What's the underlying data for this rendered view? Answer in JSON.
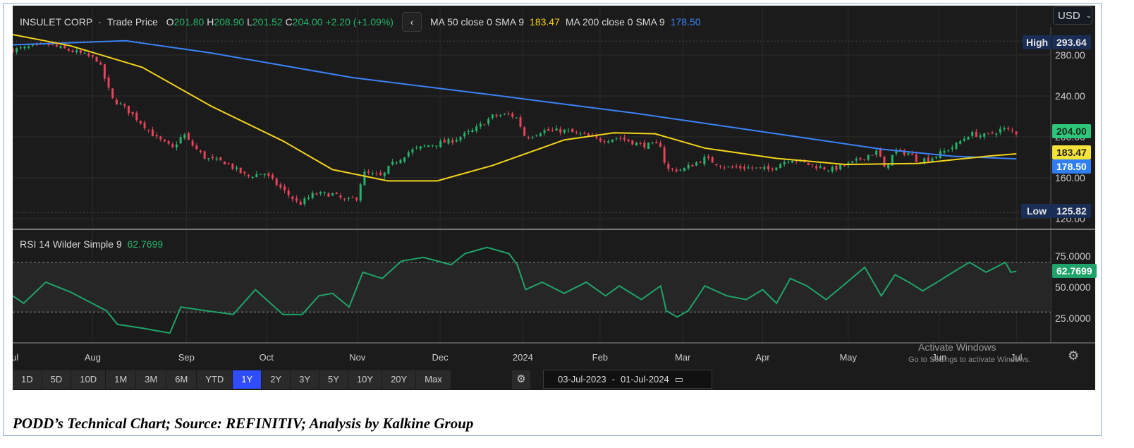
{
  "header": {
    "name": "INSULET CORP",
    "sep": "·",
    "series": "Trade Price",
    "o_label": "O",
    "o": "201.80",
    "h_label": "H",
    "h": "208.90",
    "l_label": "L",
    "l": "201.52",
    "c_label": "C",
    "c": "204.00",
    "change": "+2.20 (+1.09%)",
    "back_icon": "chevron-left-icon",
    "ma50_label": "MA 50 close 0 SMA 9",
    "ma50_value": "183.47",
    "ma200_label": "MA 200 close 0 SMA 9",
    "ma200_value": "178.50"
  },
  "currency": {
    "value": "USD",
    "icon": "chevron-down-icon"
  },
  "price_tags": {
    "high_label": "High",
    "high": "293.64",
    "low_label": "Low",
    "low": "125.82",
    "last": "204.00",
    "ma50": "183.47",
    "ma200": "178.50"
  },
  "rsi": {
    "label": "RSI 14 Wilder Simple 9",
    "value": "62.7699"
  },
  "ranges": [
    "1D",
    "5D",
    "10D",
    "1M",
    "3M",
    "6M",
    "YTD",
    "1Y",
    "2Y",
    "3Y",
    "5Y",
    "10Y",
    "20Y",
    "Max"
  ],
  "active_range": "1Y",
  "date_range": {
    "from": "03-Jul-2023",
    "sep": "-",
    "to": "01-Jul-2024"
  },
  "watermark": {
    "line1": "Activate Windows",
    "line2": "Go to Settings to activate Windows."
  },
  "caption": "PODD’s Technical Chart; Source: REFINITIV; Analysis by Kalkine Group",
  "colors": {
    "up": "#26b36b",
    "down": "#e8435a",
    "ma50": "#f2d31b",
    "ma200": "#3b82f6",
    "rsi": "#1fa36a",
    "bg": "#1b1b1b"
  },
  "chart_data": [
    {
      "type": "candlestick",
      "title": "INSULET CORP · Trade Price",
      "x_unit": "days since 03-Jul-2023",
      "ylim": [
        115,
        300
      ],
      "y_ticks": [
        120,
        160,
        200,
        240,
        280
      ],
      "x_ticks": [
        {
          "label": "Jul",
          "day": 0
        },
        {
          "label": "Aug",
          "day": 29
        },
        {
          "label": "Sep",
          "day": 63
        },
        {
          "label": "Oct",
          "day": 92
        },
        {
          "label": "Nov",
          "day": 125
        },
        {
          "label": "Dec",
          "day": 155
        },
        {
          "label": "2024",
          "day": 185
        },
        {
          "label": "Feb",
          "day": 213
        },
        {
          "label": "Mar",
          "day": 243
        },
        {
          "label": "Apr",
          "day": 272
        },
        {
          "label": "May",
          "day": 303
        },
        {
          "label": "Jun",
          "day": 336
        },
        {
          "label": "Jul",
          "day": 364
        }
      ],
      "close": [
        [
          0,
          285
        ],
        [
          13,
          290
        ],
        [
          24,
          282
        ],
        [
          31,
          275
        ],
        [
          36,
          237
        ],
        [
          40,
          230
        ],
        [
          47,
          213
        ],
        [
          52,
          199
        ],
        [
          58,
          189
        ],
        [
          62,
          203
        ],
        [
          64,
          195
        ],
        [
          70,
          179
        ],
        [
          77,
          175
        ],
        [
          85,
          161
        ],
        [
          91,
          165
        ],
        [
          98,
          148
        ],
        [
          104,
          134
        ],
        [
          109,
          144
        ],
        [
          116,
          144
        ],
        [
          121,
          137
        ],
        [
          125,
          141
        ],
        [
          127,
          165
        ],
        [
          134,
          161
        ],
        [
          137,
          172
        ],
        [
          144,
          186
        ],
        [
          151,
          192
        ],
        [
          159,
          196
        ],
        [
          167,
          206
        ],
        [
          174,
          220
        ],
        [
          180,
          222
        ],
        [
          183,
          218
        ],
        [
          186,
          199
        ],
        [
          192,
          206
        ],
        [
          200,
          206
        ],
        [
          205,
          203
        ],
        [
          213,
          197
        ],
        [
          220,
          199
        ],
        [
          228,
          192
        ],
        [
          235,
          192
        ],
        [
          237,
          168
        ],
        [
          243,
          168
        ],
        [
          251,
          179
        ],
        [
          259,
          170
        ],
        [
          266,
          170
        ],
        [
          274,
          168
        ],
        [
          282,
          179
        ],
        [
          290,
          172
        ],
        [
          297,
          168
        ],
        [
          305,
          175
        ],
        [
          310,
          182
        ],
        [
          314,
          186
        ],
        [
          316,
          168
        ],
        [
          320,
          186
        ],
        [
          325,
          184
        ],
        [
          328,
          177
        ],
        [
          333,
          179
        ],
        [
          338,
          186
        ],
        [
          342,
          192
        ],
        [
          347,
          203
        ],
        [
          353,
          201
        ],
        [
          359,
          208
        ],
        [
          364,
          204
        ]
      ],
      "ma50": [
        [
          0,
          300
        ],
        [
          21,
          289
        ],
        [
          47,
          268
        ],
        [
          72,
          230
        ],
        [
          98,
          196
        ],
        [
          116,
          168
        ],
        [
          136,
          157
        ],
        [
          154,
          157
        ],
        [
          174,
          172
        ],
        [
          200,
          197
        ],
        [
          218,
          204
        ],
        [
          233,
          203
        ],
        [
          251,
          189
        ],
        [
          277,
          179
        ],
        [
          302,
          173
        ],
        [
          328,
          174
        ],
        [
          353,
          181
        ],
        [
          364,
          183.47
        ]
      ],
      "ma200": [
        [
          0,
          290
        ],
        [
          21,
          292
        ],
        [
          41,
          294
        ],
        [
          72,
          282
        ],
        [
          123,
          258
        ],
        [
          174,
          241
        ],
        [
          226,
          223
        ],
        [
          277,
          203
        ],
        [
          315,
          188
        ],
        [
          341,
          181
        ],
        [
          364,
          178.5
        ]
      ]
    },
    {
      "type": "line",
      "title": "RSI 14 Wilder Simple 9",
      "ylim": [
        0,
        90
      ],
      "y_ticks": [
        25,
        50,
        75
      ],
      "bands": [
        30,
        70
      ],
      "rsi": [
        [
          0,
          43
        ],
        [
          4,
          37
        ],
        [
          12,
          54
        ],
        [
          21,
          46
        ],
        [
          34,
          31
        ],
        [
          38,
          20
        ],
        [
          47,
          17
        ],
        [
          57,
          13
        ],
        [
          61,
          34
        ],
        [
          70,
          31
        ],
        [
          80,
          28
        ],
        [
          88,
          48
        ],
        [
          98,
          28
        ],
        [
          105,
          28
        ],
        [
          111,
          43
        ],
        [
          116,
          45
        ],
        [
          122,
          34
        ],
        [
          127,
          62
        ],
        [
          134,
          57
        ],
        [
          141,
          71
        ],
        [
          149,
          74
        ],
        [
          159,
          68
        ],
        [
          164,
          77
        ],
        [
          172,
          82
        ],
        [
          180,
          77
        ],
        [
          183,
          68
        ],
        [
          186,
          48
        ],
        [
          192,
          54
        ],
        [
          200,
          45
        ],
        [
          208,
          54
        ],
        [
          215,
          43
        ],
        [
          220,
          51
        ],
        [
          228,
          40
        ],
        [
          235,
          51
        ],
        [
          237,
          31
        ],
        [
          241,
          26
        ],
        [
          245,
          31
        ],
        [
          251,
          51
        ],
        [
          259,
          43
        ],
        [
          266,
          40
        ],
        [
          272,
          48
        ],
        [
          277,
          37
        ],
        [
          282,
          57
        ],
        [
          288,
          51
        ],
        [
          295,
          40
        ],
        [
          301,
          51
        ],
        [
          309,
          66
        ],
        [
          315,
          43
        ],
        [
          320,
          60
        ],
        [
          325,
          54
        ],
        [
          330,
          47
        ],
        [
          336,
          55
        ],
        [
          341,
          62
        ],
        [
          347,
          70
        ],
        [
          353,
          62
        ],
        [
          360,
          70
        ],
        [
          362,
          62
        ],
        [
          364,
          62.77
        ]
      ]
    }
  ]
}
